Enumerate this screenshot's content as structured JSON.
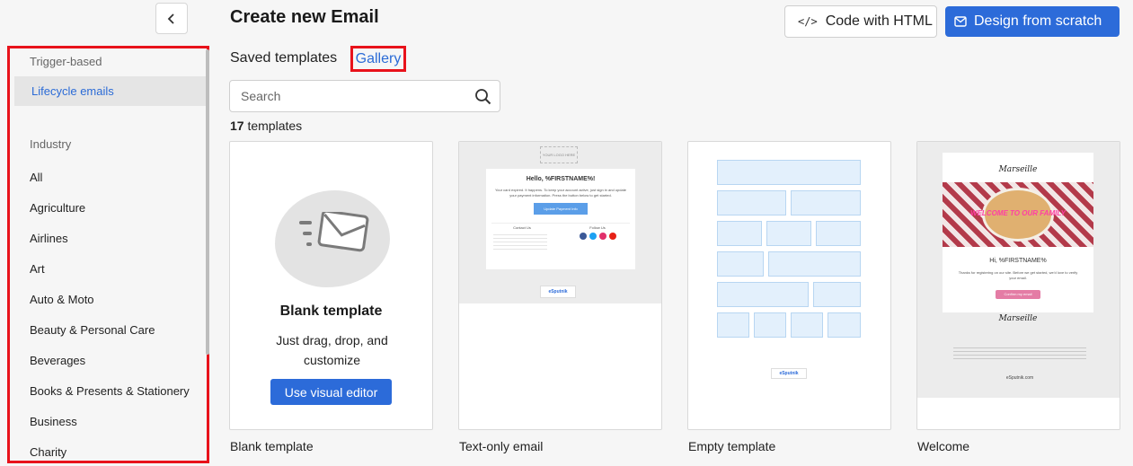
{
  "header": {
    "title": "Create new Email",
    "code_html_label": "Code with HTML",
    "code_html_icon": "</>",
    "design_label": "Design from scratch"
  },
  "tabs": {
    "saved": "Saved templates",
    "gallery": "Gallery"
  },
  "search": {
    "placeholder": "Search"
  },
  "count": {
    "number": "17",
    "label": " templates"
  },
  "sidebar": {
    "group_trigger": "Trigger-based",
    "active_item": "Lifecycle emails",
    "group_industry": "Industry",
    "items": [
      "All",
      "Agriculture",
      "Airlines",
      "Art",
      "Auto & Moto",
      "Beauty & Personal Care",
      "Beverages",
      "Books & Presents & Stationery",
      "Business",
      "Charity"
    ]
  },
  "cards": {
    "blank": {
      "title": "Blank template",
      "desc": "Just drag, drop, and customize",
      "button": "Use visual editor",
      "label": "Blank template"
    },
    "text_only": {
      "label": "Text-only email",
      "logo": "YOUR LOGO HERE",
      "greeting": "Hello, %FIRSTNAME%!",
      "body": "Your card expired. It happens. To keep your account active, just sign in and update your payment information. Press the button below to get started.",
      "button": "Update Payment Info",
      "contact_title": "Contact Us",
      "follow_title": "Follow Us",
      "brand": "eSputnik"
    },
    "empty": {
      "label": "Empty template",
      "brand": "eSputnik"
    },
    "welcome": {
      "label": "Welcome",
      "brand_name": "Marseille",
      "banner": "WELCOME TO OUR FAMILY",
      "greeting": "Hi, %FIRSTNAME%",
      "body": "Thanks for registering on our site. Before we get started, we'd love to verify your email.",
      "button": "Confirm my email",
      "brand": "eSputnik.com"
    }
  },
  "colors": {
    "accent": "#2c6bd9",
    "highlight": "#e8121b",
    "link": "#2b6bd6"
  }
}
